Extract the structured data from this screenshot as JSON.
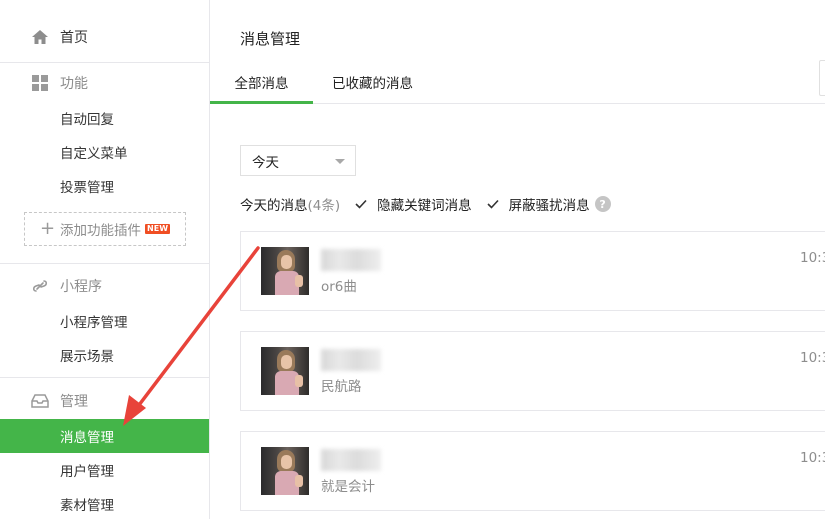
{
  "sidebar": {
    "home": {
      "label": "首页",
      "icon": "home-icon"
    },
    "groups": [
      {
        "title": "功能",
        "icon": "grid-icon",
        "items": [
          "自动回复",
          "自定义菜单",
          "投票管理"
        ]
      },
      {
        "title": "小程序",
        "icon": "link-icon",
        "items": [
          "小程序管理",
          "展示场景"
        ]
      },
      {
        "title": "管理",
        "icon": "inbox-icon",
        "items": [
          "消息管理",
          "用户管理",
          "素材管理"
        ]
      }
    ],
    "add_plugin": {
      "label": "添加功能插件",
      "badge": "NEW"
    },
    "active_item": "消息管理",
    "accent_color": "#44b549"
  },
  "main": {
    "title": "消息管理",
    "tabs": [
      {
        "label": "全部消息",
        "active": true
      },
      {
        "label": "已收藏的消息",
        "active": false
      }
    ],
    "date_select": {
      "value": "今天"
    },
    "filter": {
      "summary_label": "今天的消息",
      "summary_count": "(4条)",
      "hide_keyword": {
        "label": "隐藏关键词消息",
        "checked": true
      },
      "block_spam": {
        "label": "屏蔽骚扰消息",
        "checked": true
      },
      "help": "?"
    },
    "messages": [
      {
        "nickname": "丽",
        "preview": "or6曲",
        "time": "10:3"
      },
      {
        "nickname": "丽",
        "preview": "民航路",
        "time": "10:3"
      },
      {
        "nickname": "丽",
        "preview": "就是会计",
        "time": "10:3"
      }
    ]
  }
}
